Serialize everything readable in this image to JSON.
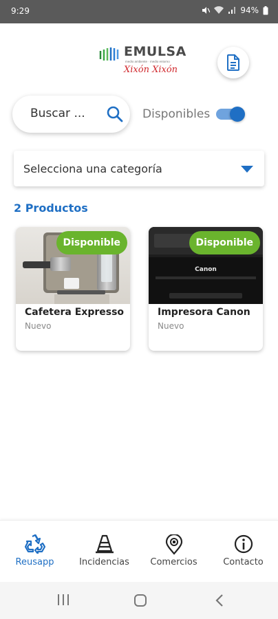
{
  "status_bar": {
    "time": "9:29",
    "battery": "94%"
  },
  "header": {
    "logo": {
      "word": "EMULSA",
      "tagline": "medio ambiente · medio entorno",
      "signature": "Xixón Xixón"
    }
  },
  "search": {
    "placeholder": "Buscar ...",
    "value": ""
  },
  "filter": {
    "toggle_label": "Disponibles",
    "toggle_on": true
  },
  "category_select": {
    "selected": "Selecciona una categoría"
  },
  "products": {
    "count_label": "2 Productos",
    "items": [
      {
        "title": "Cafetera Expresso",
        "condition": "Nuevo",
        "badge": "Disponible",
        "image": "espresso-machine"
      },
      {
        "title": "Impresora Canon",
        "condition": "Nuevo",
        "badge": "Disponible",
        "image": "canon-printer",
        "brand_text": "Canon"
      }
    ]
  },
  "bottom_nav": {
    "items": [
      {
        "label": "Reusapp",
        "icon": "recycle-icon",
        "active": true
      },
      {
        "label": "Incidencias",
        "icon": "traffic-cone-icon",
        "active": false
      },
      {
        "label": "Comercios",
        "icon": "map-pin-icon",
        "active": false
      },
      {
        "label": "Contacto",
        "icon": "info-icon",
        "active": false
      }
    ]
  },
  "colors": {
    "accent": "#1f6fc4",
    "badge_green": "#6ab42d",
    "status_bar": "#5a5a5a",
    "logo_red": "#d0272c"
  }
}
